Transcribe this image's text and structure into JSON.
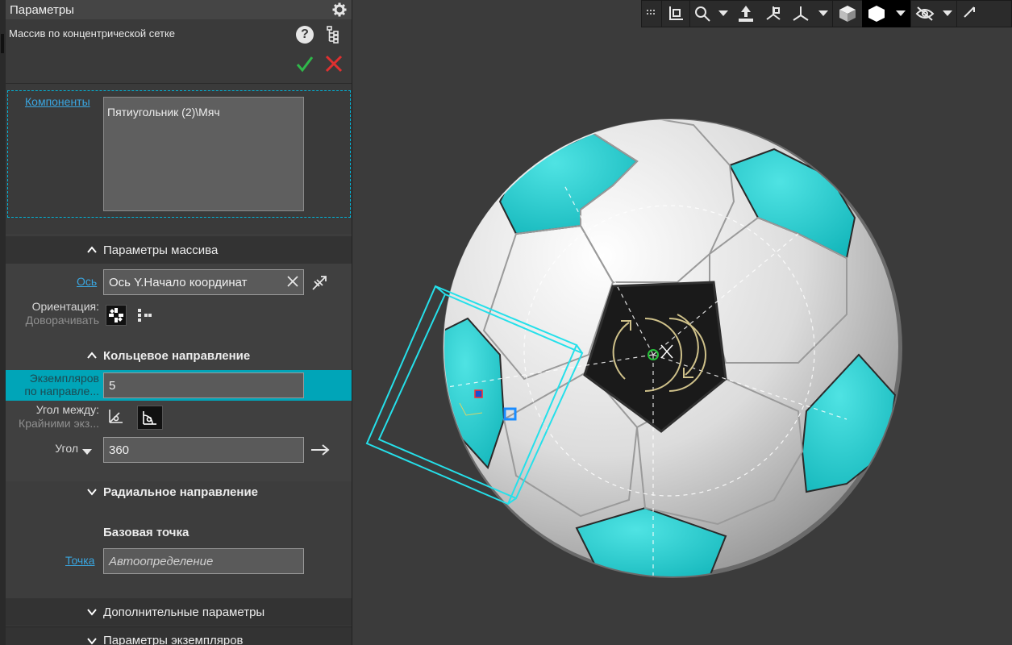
{
  "panel": {
    "title": "Параметры",
    "operation_title": "Массив по концентрической сетке",
    "components_link": "Компоненты",
    "components_value": "Пятиугольник  (2)\\Мяч",
    "sections": {
      "array_params": "Параметры массива",
      "ring_direction": "Кольцевое направление",
      "radial_direction": "Радиальное направление",
      "base_point": "Базовая точка",
      "extra_params": "Дополнительные параметры",
      "instance_params": "Параметры экземпляров"
    },
    "axis_link": "Ось",
    "axis_value": "Ось Y.Начало координат",
    "orientation_label": "Ориентация:",
    "orientation_sub": "Доворачивать",
    "instances_label_1": "Экземпляров",
    "instances_label_2": "по направле...",
    "instances_value": "5",
    "angle_between_label": "Угол между:",
    "angle_between_sub": "Крайними экз...",
    "angle_label": "Угол",
    "angle_value": "360",
    "point_link": "Точка",
    "point_placeholder": "Автоопределение"
  },
  "colors": {
    "accent": "#00a5b8",
    "link": "#3aa6e0",
    "ok": "#2fb84a",
    "cancel": "#e03030",
    "ball_cyan": "#1ec8cc",
    "ball_white": "#e4e4e4",
    "ball_dark": "#1a1a1a"
  },
  "toolbar": {
    "icons": [
      "grip-icon",
      "frame-icon",
      "zoom-icon",
      "orient-icon",
      "view-icon",
      "axes-icon",
      "shaded-cube-icon",
      "solid-cube-icon",
      "hide-icon"
    ]
  }
}
